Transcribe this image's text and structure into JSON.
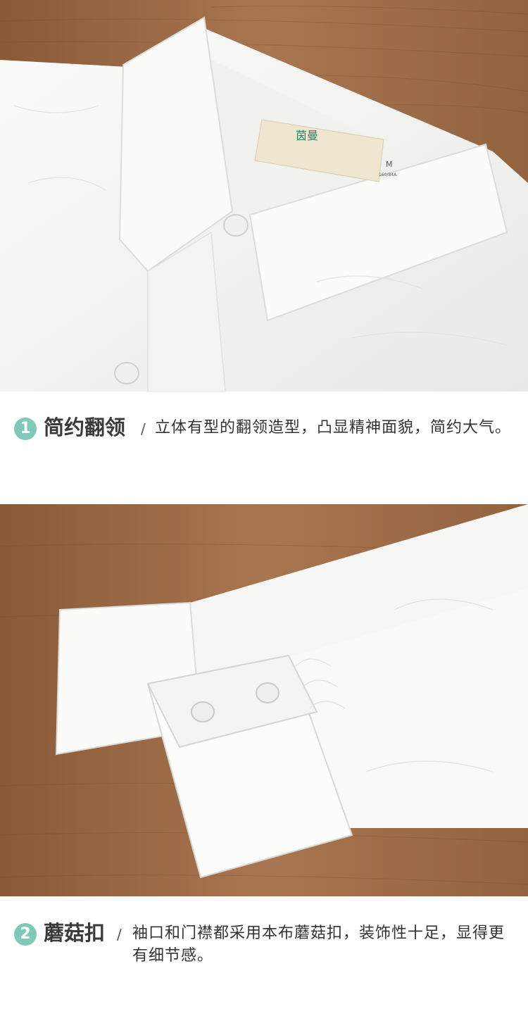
{
  "images": {
    "collar": {
      "alt": "collar-photo",
      "label_brand": "茵曼",
      "label_size": "M",
      "label_spec": "160/84A"
    },
    "cuff": {
      "alt": "cuff-photo"
    }
  },
  "features": [
    {
      "number": "1",
      "title": "简约翻领",
      "separator": "/",
      "description": "立体有型的翻领造型，凸显精神面貌，简约大气。"
    },
    {
      "number": "2",
      "title": "蘑菇扣",
      "separator": "/",
      "description": "袖口和门襟都采用本布蘑菇扣，装饰性十足，显得更有细节感。"
    }
  ],
  "colors": {
    "badge": "#7ec9ba",
    "wood": "#9a6a45",
    "shirt": "#f7f7f5"
  }
}
